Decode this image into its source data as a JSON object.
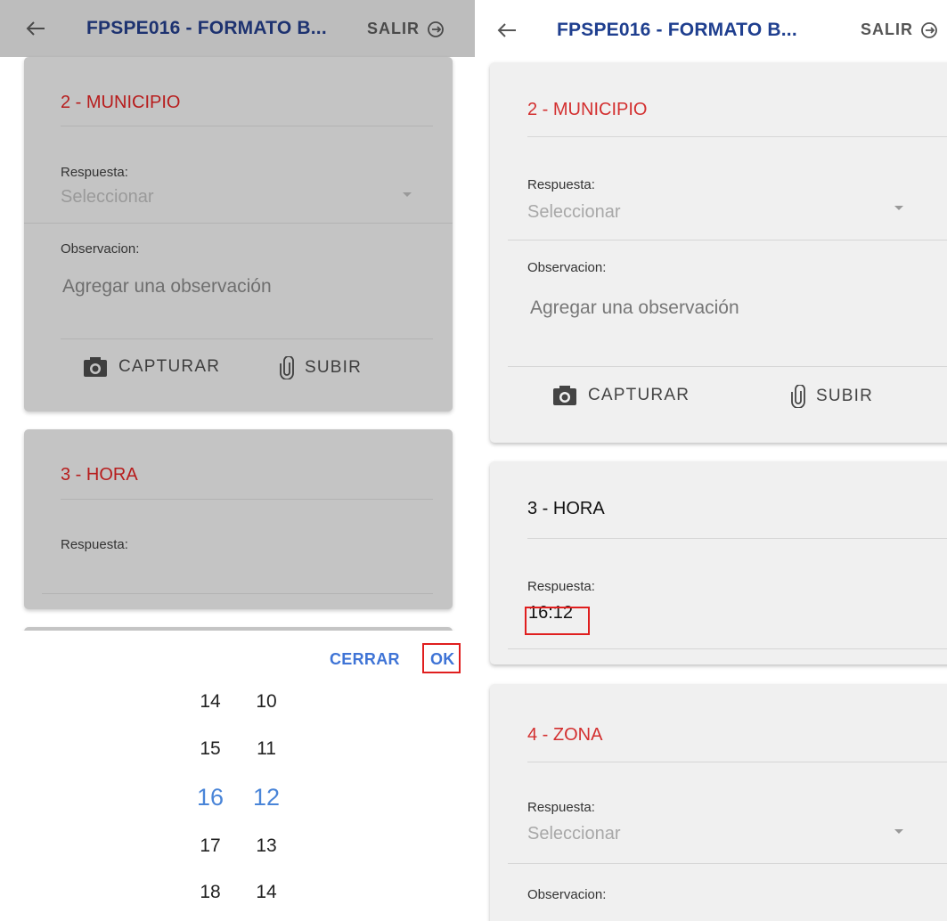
{
  "appbar": {
    "title": "FPSPE016 - FORMATO B...",
    "exit_label": "SALIR",
    "back_icon": "arrow-left-icon",
    "exit_icon": "logout-icon"
  },
  "cards": {
    "municipio": {
      "title": "2 - MUNICIPIO",
      "answer_label": "Respuesta:",
      "answer_placeholder": "Seleccionar",
      "observation_label": "Observacion:",
      "observation_placeholder": "Agregar una observación",
      "capture_label": "CAPTURAR",
      "upload_label": "SUBIR"
    },
    "hora": {
      "title": "3 - HORA",
      "answer_label": "Respuesta:",
      "answer_value": "16:12"
    },
    "zona": {
      "title": "4 - ZONA",
      "answer_label": "Respuesta:",
      "answer_placeholder": "Seleccionar",
      "observation_label": "Observacion:"
    }
  },
  "time_picker": {
    "close_label": "CERRAR",
    "ok_label": "OK",
    "hours": [
      "14",
      "15",
      "16",
      "17",
      "18"
    ],
    "minutes": [
      "10",
      "11",
      "12",
      "13",
      "14"
    ],
    "selected_hour": "16",
    "selected_minute": "12"
  },
  "colors": {
    "title_blue": "#1f3f8f",
    "section_red": "#d32f2f",
    "picker_blue": "#3f74d6",
    "highlight_red": "#e01e1e"
  }
}
